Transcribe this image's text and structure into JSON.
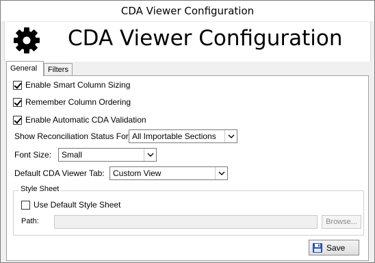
{
  "window": {
    "title": "CDA Viewer Configuration"
  },
  "header": {
    "title": "CDA Viewer Configuration",
    "icon": "gear-icon"
  },
  "tabs": [
    {
      "label": "General",
      "active": true
    },
    {
      "label": "Filters",
      "active": false
    }
  ],
  "general": {
    "smart_column_sizing": {
      "label": "Enable Smart Column Sizing",
      "checked": true
    },
    "remember_column_ordering": {
      "label": "Remember Column Ordering",
      "checked": true
    },
    "automatic_validation": {
      "label": "Enable Automatic CDA Validation",
      "checked": true
    },
    "reconciliation": {
      "label": "Show Reconciliation Status For:",
      "value": "All Importable Sections"
    },
    "font_size": {
      "label": "Font Size:",
      "value": "Small"
    },
    "default_tab": {
      "label": "Default CDA Viewer Tab:",
      "value": "Custom View"
    },
    "style_sheet": {
      "legend": "Style Sheet",
      "use_default": {
        "label": "Use Default Style Sheet",
        "checked": false
      },
      "path_label": "Path:",
      "path_value": "",
      "browse_label": "Browse..."
    }
  },
  "footer": {
    "save_label": "Save",
    "save_icon": "floppy-disk-icon"
  },
  "colors": {
    "save_icon_blue": "#2a4fb0",
    "border": "#a0a0a0",
    "disabled_text": "#8a8a8a"
  }
}
